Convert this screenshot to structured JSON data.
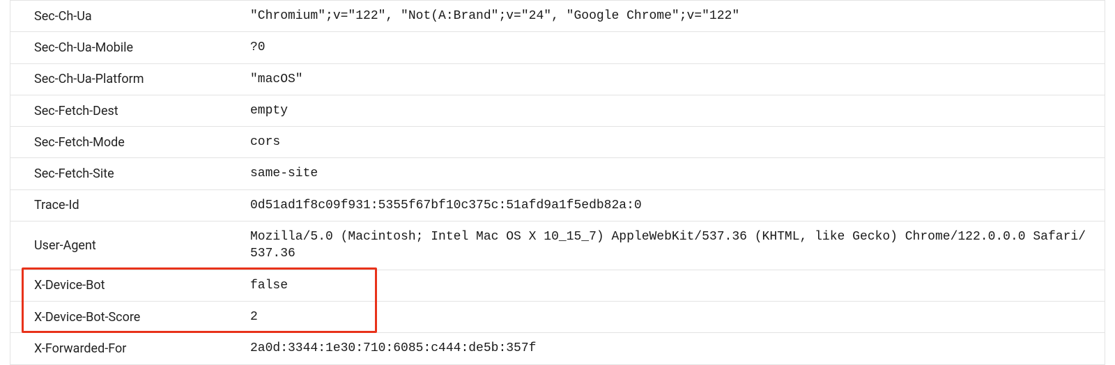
{
  "headers": [
    {
      "name": "Sec-Ch-Ua",
      "value": "\"Chromium\";v=\"122\", \"Not(A:Brand\";v=\"24\", \"Google Chrome\";v=\"122\""
    },
    {
      "name": "Sec-Ch-Ua-Mobile",
      "value": "?0"
    },
    {
      "name": "Sec-Ch-Ua-Platform",
      "value": "\"macOS\""
    },
    {
      "name": "Sec-Fetch-Dest",
      "value": "empty"
    },
    {
      "name": "Sec-Fetch-Mode",
      "value": "cors"
    },
    {
      "name": "Sec-Fetch-Site",
      "value": "same-site"
    },
    {
      "name": "Trace-Id",
      "value": "0d51ad1f8c09f931:5355f67bf10c375c:51afd9a1f5edb82a:0"
    },
    {
      "name": "User-Agent",
      "value": "Mozilla/5.0 (Macintosh; Intel Mac OS X 10_15_7) AppleWebKit/537.36 (KHTML, like Gecko) Chrome/122.0.0.0 Safari/537.36"
    },
    {
      "name": "X-Device-Bot",
      "value": "false"
    },
    {
      "name": "X-Device-Bot-Score",
      "value": "2"
    },
    {
      "name": "X-Forwarded-For",
      "value": "2a0d:3344:1e30:710:6085:c444:de5b:357f"
    }
  ],
  "highlight": {
    "color": "#e8321a"
  }
}
